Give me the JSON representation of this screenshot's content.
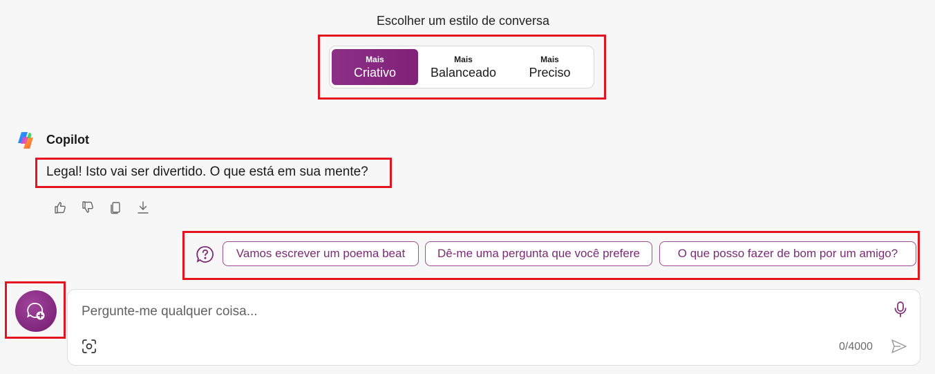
{
  "tone": {
    "title": "Escolher um estilo de conversa",
    "options": [
      {
        "small": "Mais",
        "label": "Criativo",
        "active": true
      },
      {
        "small": "Mais",
        "label": "Balanceado",
        "active": false
      },
      {
        "small": "Mais",
        "label": "Preciso",
        "active": false
      }
    ]
  },
  "chat": {
    "assistant_name": "Copilot",
    "message": "Legal! Isto vai ser divertido. O que está em sua mente?"
  },
  "message_actions": [
    "thumbs-up-icon",
    "thumbs-down-icon",
    "copy-icon",
    "download-icon"
  ],
  "suggestions": [
    "Vamos escrever um poema beat",
    "Dê-me uma pergunta que você prefere",
    "O que posso fazer de bom por um amigo?"
  ],
  "composer": {
    "placeholder": "Pergunte-me qualquer coisa...",
    "char_count": "0/4000"
  },
  "colors": {
    "accent": "#7f2278",
    "highlight": "#e3141f",
    "background": "#f7f7f7"
  }
}
